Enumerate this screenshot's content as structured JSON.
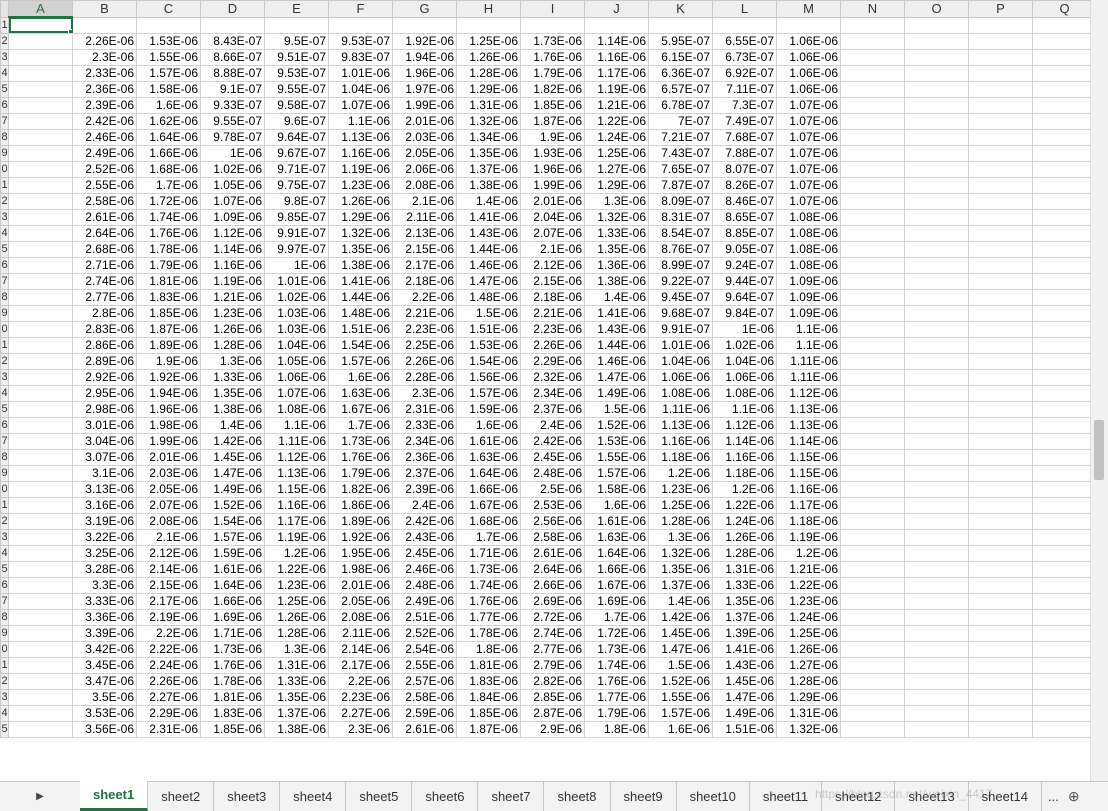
{
  "columns": [
    "A",
    "B",
    "C",
    "D",
    "E",
    "F",
    "G",
    "H",
    "I",
    "J",
    "K",
    "L",
    "M",
    "N",
    "O",
    "P",
    "Q"
  ],
  "row_labels": [
    "1",
    "2",
    "3",
    "4",
    "5",
    "6",
    "7",
    "8",
    "9",
    "0",
    "1",
    "2",
    "3",
    "4",
    "5",
    "6",
    "7",
    "8",
    "9",
    "0",
    "1",
    "2",
    "3",
    "4",
    "5",
    "6",
    "7",
    "8",
    "9",
    "0",
    "1",
    "2",
    "3",
    "4",
    "5",
    "6",
    "7",
    "8",
    "9",
    "0",
    "1",
    "2",
    "3",
    "4",
    "5"
  ],
  "rows": [
    [
      "",
      "",
      "",
      "",
      "",
      "",
      "",
      "",
      "",
      "",
      "",
      "",
      ""
    ],
    [
      "",
      "2.26E-06",
      "1.53E-06",
      "8.43E-07",
      "9.5E-07",
      "9.53E-07",
      "1.92E-06",
      "1.25E-06",
      "1.73E-06",
      "1.14E-06",
      "5.95E-07",
      "6.55E-07",
      "1.06E-06"
    ],
    [
      "",
      "2.3E-06",
      "1.55E-06",
      "8.66E-07",
      "9.51E-07",
      "9.83E-07",
      "1.94E-06",
      "1.26E-06",
      "1.76E-06",
      "1.16E-06",
      "6.15E-07",
      "6.73E-07",
      "1.06E-06"
    ],
    [
      "",
      "2.33E-06",
      "1.57E-06",
      "8.88E-07",
      "9.53E-07",
      "1.01E-06",
      "1.96E-06",
      "1.28E-06",
      "1.79E-06",
      "1.17E-06",
      "6.36E-07",
      "6.92E-07",
      "1.06E-06"
    ],
    [
      "",
      "2.36E-06",
      "1.58E-06",
      "9.1E-07",
      "9.55E-07",
      "1.04E-06",
      "1.97E-06",
      "1.29E-06",
      "1.82E-06",
      "1.19E-06",
      "6.57E-07",
      "7.11E-07",
      "1.06E-06"
    ],
    [
      "",
      "2.39E-06",
      "1.6E-06",
      "9.33E-07",
      "9.58E-07",
      "1.07E-06",
      "1.99E-06",
      "1.31E-06",
      "1.85E-06",
      "1.21E-06",
      "6.78E-07",
      "7.3E-07",
      "1.07E-06"
    ],
    [
      "",
      "2.42E-06",
      "1.62E-06",
      "9.55E-07",
      "9.6E-07",
      "1.1E-06",
      "2.01E-06",
      "1.32E-06",
      "1.87E-06",
      "1.22E-06",
      "7E-07",
      "7.49E-07",
      "1.07E-06"
    ],
    [
      "",
      "2.46E-06",
      "1.64E-06",
      "9.78E-07",
      "9.64E-07",
      "1.13E-06",
      "2.03E-06",
      "1.34E-06",
      "1.9E-06",
      "1.24E-06",
      "7.21E-07",
      "7.68E-07",
      "1.07E-06"
    ],
    [
      "",
      "2.49E-06",
      "1.66E-06",
      "1E-06",
      "9.67E-07",
      "1.16E-06",
      "2.05E-06",
      "1.35E-06",
      "1.93E-06",
      "1.25E-06",
      "7.43E-07",
      "7.88E-07",
      "1.07E-06"
    ],
    [
      "",
      "2.52E-06",
      "1.68E-06",
      "1.02E-06",
      "9.71E-07",
      "1.19E-06",
      "2.06E-06",
      "1.37E-06",
      "1.96E-06",
      "1.27E-06",
      "7.65E-07",
      "8.07E-07",
      "1.07E-06"
    ],
    [
      "",
      "2.55E-06",
      "1.7E-06",
      "1.05E-06",
      "9.75E-07",
      "1.23E-06",
      "2.08E-06",
      "1.38E-06",
      "1.99E-06",
      "1.29E-06",
      "7.87E-07",
      "8.26E-07",
      "1.07E-06"
    ],
    [
      "",
      "2.58E-06",
      "1.72E-06",
      "1.07E-06",
      "9.8E-07",
      "1.26E-06",
      "2.1E-06",
      "1.4E-06",
      "2.01E-06",
      "1.3E-06",
      "8.09E-07",
      "8.46E-07",
      "1.07E-06"
    ],
    [
      "",
      "2.61E-06",
      "1.74E-06",
      "1.09E-06",
      "9.85E-07",
      "1.29E-06",
      "2.11E-06",
      "1.41E-06",
      "2.04E-06",
      "1.32E-06",
      "8.31E-07",
      "8.65E-07",
      "1.08E-06"
    ],
    [
      "",
      "2.64E-06",
      "1.76E-06",
      "1.12E-06",
      "9.91E-07",
      "1.32E-06",
      "2.13E-06",
      "1.43E-06",
      "2.07E-06",
      "1.33E-06",
      "8.54E-07",
      "8.85E-07",
      "1.08E-06"
    ],
    [
      "",
      "2.68E-06",
      "1.78E-06",
      "1.14E-06",
      "9.97E-07",
      "1.35E-06",
      "2.15E-06",
      "1.44E-06",
      "2.1E-06",
      "1.35E-06",
      "8.76E-07",
      "9.05E-07",
      "1.08E-06"
    ],
    [
      "",
      "2.71E-06",
      "1.79E-06",
      "1.16E-06",
      "1E-06",
      "1.38E-06",
      "2.17E-06",
      "1.46E-06",
      "2.12E-06",
      "1.36E-06",
      "8.99E-07",
      "9.24E-07",
      "1.08E-06"
    ],
    [
      "",
      "2.74E-06",
      "1.81E-06",
      "1.19E-06",
      "1.01E-06",
      "1.41E-06",
      "2.18E-06",
      "1.47E-06",
      "2.15E-06",
      "1.38E-06",
      "9.22E-07",
      "9.44E-07",
      "1.09E-06"
    ],
    [
      "",
      "2.77E-06",
      "1.83E-06",
      "1.21E-06",
      "1.02E-06",
      "1.44E-06",
      "2.2E-06",
      "1.48E-06",
      "2.18E-06",
      "1.4E-06",
      "9.45E-07",
      "9.64E-07",
      "1.09E-06"
    ],
    [
      "",
      "2.8E-06",
      "1.85E-06",
      "1.23E-06",
      "1.03E-06",
      "1.48E-06",
      "2.21E-06",
      "1.5E-06",
      "2.21E-06",
      "1.41E-06",
      "9.68E-07",
      "9.84E-07",
      "1.09E-06"
    ],
    [
      "",
      "2.83E-06",
      "1.87E-06",
      "1.26E-06",
      "1.03E-06",
      "1.51E-06",
      "2.23E-06",
      "1.51E-06",
      "2.23E-06",
      "1.43E-06",
      "9.91E-07",
      "1E-06",
      "1.1E-06"
    ],
    [
      "",
      "2.86E-06",
      "1.89E-06",
      "1.28E-06",
      "1.04E-06",
      "1.54E-06",
      "2.25E-06",
      "1.53E-06",
      "2.26E-06",
      "1.44E-06",
      "1.01E-06",
      "1.02E-06",
      "1.1E-06"
    ],
    [
      "",
      "2.89E-06",
      "1.9E-06",
      "1.3E-06",
      "1.05E-06",
      "1.57E-06",
      "2.26E-06",
      "1.54E-06",
      "2.29E-06",
      "1.46E-06",
      "1.04E-06",
      "1.04E-06",
      "1.11E-06"
    ],
    [
      "",
      "2.92E-06",
      "1.92E-06",
      "1.33E-06",
      "1.06E-06",
      "1.6E-06",
      "2.28E-06",
      "1.56E-06",
      "2.32E-06",
      "1.47E-06",
      "1.06E-06",
      "1.06E-06",
      "1.11E-06"
    ],
    [
      "",
      "2.95E-06",
      "1.94E-06",
      "1.35E-06",
      "1.07E-06",
      "1.63E-06",
      "2.3E-06",
      "1.57E-06",
      "2.34E-06",
      "1.49E-06",
      "1.08E-06",
      "1.08E-06",
      "1.12E-06"
    ],
    [
      "",
      "2.98E-06",
      "1.96E-06",
      "1.38E-06",
      "1.08E-06",
      "1.67E-06",
      "2.31E-06",
      "1.59E-06",
      "2.37E-06",
      "1.5E-06",
      "1.11E-06",
      "1.1E-06",
      "1.13E-06"
    ],
    [
      "",
      "3.01E-06",
      "1.98E-06",
      "1.4E-06",
      "1.1E-06",
      "1.7E-06",
      "2.33E-06",
      "1.6E-06",
      "2.4E-06",
      "1.52E-06",
      "1.13E-06",
      "1.12E-06",
      "1.13E-06"
    ],
    [
      "",
      "3.04E-06",
      "1.99E-06",
      "1.42E-06",
      "1.11E-06",
      "1.73E-06",
      "2.34E-06",
      "1.61E-06",
      "2.42E-06",
      "1.53E-06",
      "1.16E-06",
      "1.14E-06",
      "1.14E-06"
    ],
    [
      "",
      "3.07E-06",
      "2.01E-06",
      "1.45E-06",
      "1.12E-06",
      "1.76E-06",
      "2.36E-06",
      "1.63E-06",
      "2.45E-06",
      "1.55E-06",
      "1.18E-06",
      "1.16E-06",
      "1.15E-06"
    ],
    [
      "",
      "3.1E-06",
      "2.03E-06",
      "1.47E-06",
      "1.13E-06",
      "1.79E-06",
      "2.37E-06",
      "1.64E-06",
      "2.48E-06",
      "1.57E-06",
      "1.2E-06",
      "1.18E-06",
      "1.15E-06"
    ],
    [
      "",
      "3.13E-06",
      "2.05E-06",
      "1.49E-06",
      "1.15E-06",
      "1.82E-06",
      "2.39E-06",
      "1.66E-06",
      "2.5E-06",
      "1.58E-06",
      "1.23E-06",
      "1.2E-06",
      "1.16E-06"
    ],
    [
      "",
      "3.16E-06",
      "2.07E-06",
      "1.52E-06",
      "1.16E-06",
      "1.86E-06",
      "2.4E-06",
      "1.67E-06",
      "2.53E-06",
      "1.6E-06",
      "1.25E-06",
      "1.22E-06",
      "1.17E-06"
    ],
    [
      "",
      "3.19E-06",
      "2.08E-06",
      "1.54E-06",
      "1.17E-06",
      "1.89E-06",
      "2.42E-06",
      "1.68E-06",
      "2.56E-06",
      "1.61E-06",
      "1.28E-06",
      "1.24E-06",
      "1.18E-06"
    ],
    [
      "",
      "3.22E-06",
      "2.1E-06",
      "1.57E-06",
      "1.19E-06",
      "1.92E-06",
      "2.43E-06",
      "1.7E-06",
      "2.58E-06",
      "1.63E-06",
      "1.3E-06",
      "1.26E-06",
      "1.19E-06"
    ],
    [
      "",
      "3.25E-06",
      "2.12E-06",
      "1.59E-06",
      "1.2E-06",
      "1.95E-06",
      "2.45E-06",
      "1.71E-06",
      "2.61E-06",
      "1.64E-06",
      "1.32E-06",
      "1.28E-06",
      "1.2E-06"
    ],
    [
      "",
      "3.28E-06",
      "2.14E-06",
      "1.61E-06",
      "1.22E-06",
      "1.98E-06",
      "2.46E-06",
      "1.73E-06",
      "2.64E-06",
      "1.66E-06",
      "1.35E-06",
      "1.31E-06",
      "1.21E-06"
    ],
    [
      "",
      "3.3E-06",
      "2.15E-06",
      "1.64E-06",
      "1.23E-06",
      "2.01E-06",
      "2.48E-06",
      "1.74E-06",
      "2.66E-06",
      "1.67E-06",
      "1.37E-06",
      "1.33E-06",
      "1.22E-06"
    ],
    [
      "",
      "3.33E-06",
      "2.17E-06",
      "1.66E-06",
      "1.25E-06",
      "2.05E-06",
      "2.49E-06",
      "1.76E-06",
      "2.69E-06",
      "1.69E-06",
      "1.4E-06",
      "1.35E-06",
      "1.23E-06"
    ],
    [
      "",
      "3.36E-06",
      "2.19E-06",
      "1.69E-06",
      "1.26E-06",
      "2.08E-06",
      "2.51E-06",
      "1.77E-06",
      "2.72E-06",
      "1.7E-06",
      "1.42E-06",
      "1.37E-06",
      "1.24E-06"
    ],
    [
      "",
      "3.39E-06",
      "2.2E-06",
      "1.71E-06",
      "1.28E-06",
      "2.11E-06",
      "2.52E-06",
      "1.78E-06",
      "2.74E-06",
      "1.72E-06",
      "1.45E-06",
      "1.39E-06",
      "1.25E-06"
    ],
    [
      "",
      "3.42E-06",
      "2.22E-06",
      "1.73E-06",
      "1.3E-06",
      "2.14E-06",
      "2.54E-06",
      "1.8E-06",
      "2.77E-06",
      "1.73E-06",
      "1.47E-06",
      "1.41E-06",
      "1.26E-06"
    ],
    [
      "",
      "3.45E-06",
      "2.24E-06",
      "1.76E-06",
      "1.31E-06",
      "2.17E-06",
      "2.55E-06",
      "1.81E-06",
      "2.79E-06",
      "1.74E-06",
      "1.5E-06",
      "1.43E-06",
      "1.27E-06"
    ],
    [
      "",
      "3.47E-06",
      "2.26E-06",
      "1.78E-06",
      "1.33E-06",
      "2.2E-06",
      "2.57E-06",
      "1.83E-06",
      "2.82E-06",
      "1.76E-06",
      "1.52E-06",
      "1.45E-06",
      "1.28E-06"
    ],
    [
      "",
      "3.5E-06",
      "2.27E-06",
      "1.81E-06",
      "1.35E-06",
      "2.23E-06",
      "2.58E-06",
      "1.84E-06",
      "2.85E-06",
      "1.77E-06",
      "1.55E-06",
      "1.47E-06",
      "1.29E-06"
    ],
    [
      "",
      "3.53E-06",
      "2.29E-06",
      "1.83E-06",
      "1.37E-06",
      "2.27E-06",
      "2.59E-06",
      "1.85E-06",
      "2.87E-06",
      "1.79E-06",
      "1.57E-06",
      "1.49E-06",
      "1.31E-06"
    ],
    [
      "",
      "3.56E-06",
      "2.31E-06",
      "1.85E-06",
      "1.38E-06",
      "2.3E-06",
      "2.61E-06",
      "1.87E-06",
      "2.9E-06",
      "1.8E-06",
      "1.6E-06",
      "1.51E-06",
      "1.32E-06"
    ]
  ],
  "sheet_tabs": [
    "sheet1",
    "sheet2",
    "sheet3",
    "sheet4",
    "sheet5",
    "sheet6",
    "sheet7",
    "sheet8",
    "sheet9",
    "sheet10",
    "sheet11",
    "sheet12",
    "sheet13",
    "sheet14"
  ],
  "active_sheet": "sheet1",
  "tab_nav_glyph": "▶",
  "tab_more_label": "...",
  "add_sheet_glyph": "⊕",
  "watermark": "https://blog.csdn.net/weixin_4417..."
}
